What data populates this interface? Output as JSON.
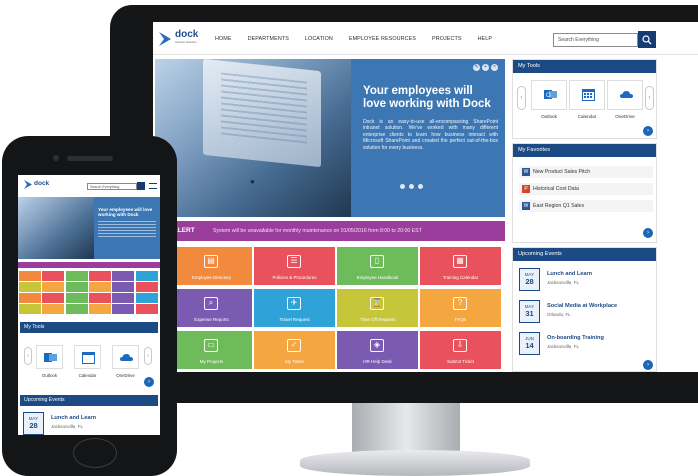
{
  "desktop": {
    "brand": {
      "name": "dock",
      "tagline": "Intranet Solution"
    },
    "nav": [
      "HOME",
      "DEPARTMENTS",
      "LOCATION",
      "EMPLOYEE RESOURCES",
      "PROJECTS",
      "HELP"
    ],
    "search": {
      "placeholder": "Search Everything"
    },
    "hero": {
      "title": "Your employees will love working with Dock",
      "body": "Dock is an easy-to-use all-encompassing SharePoint intranet solution. We've worked with many different enterprise clients to learn how business interact with Microsoft SharePoint and created the perfect out-of-the-box solution for every business.",
      "dots": 3
    },
    "alert": {
      "label": "ALERT",
      "text": "System will be unavailable for monthly maintenance on 01/05/2016 from 8:00 to 20:00 EST"
    },
    "tiles": [
      {
        "label": "Employee Directory",
        "color": "#f28a3e",
        "icon": "directory-icon"
      },
      {
        "label": "Policies & Procedures",
        "color": "#e9515c",
        "icon": "policies-icon"
      },
      {
        "label": "Employee Handbook",
        "color": "#6dbb5b",
        "icon": "handbook-icon"
      },
      {
        "label": "Training Calendar",
        "color": "#e9515c",
        "icon": "calendar-icon"
      },
      {
        "label": "Expense Reports",
        "color": "#7b5ab1",
        "icon": "expense-icon"
      },
      {
        "label": "Travel Request",
        "color": "#2fa3d8",
        "icon": "travel-icon"
      },
      {
        "label": "Time Off Request",
        "color": "#c7c63a",
        "icon": "hourglass-icon"
      },
      {
        "label": "FAQs",
        "color": "#f4a640",
        "icon": "faq-icon"
      },
      {
        "label": "My Projects",
        "color": "#6dbb5b",
        "icon": "projects-icon"
      },
      {
        "label": "My Tasks",
        "color": "#f4a640",
        "icon": "tasks-icon"
      },
      {
        "label": "HR Help Desk",
        "color": "#7b5ab1",
        "icon": "handshake-icon"
      },
      {
        "label": "Submit Ticket",
        "color": "#e9515c",
        "icon": "ticket-icon"
      }
    ],
    "my_tools": {
      "title": "My Tools",
      "items": [
        "Outlook",
        "Calendar",
        "OneDrive"
      ]
    },
    "my_favorites": {
      "title": "My Favorites",
      "items": [
        {
          "label": "New Product Sales Pitch",
          "icon": "word-icon",
          "color": "#2b5797"
        },
        {
          "label": "Historical Cost Data",
          "icon": "powerpoint-icon",
          "color": "#d24726"
        },
        {
          "label": "East Region Q1 Sales",
          "icon": "word-icon",
          "color": "#2b5797"
        }
      ]
    },
    "events": {
      "title": "Upcoming Events",
      "items": [
        {
          "month": "MAY",
          "day": "28",
          "title": "Lunch and Learn",
          "location": "Jacksonville, FL"
        },
        {
          "month": "MAY",
          "day": "31",
          "title": "Social Media at Workplace",
          "location": "Orlando, FL"
        },
        {
          "month": "JUN",
          "day": "14",
          "title": "On-boarding Training",
          "location": "Jacksonville, FL"
        }
      ]
    }
  },
  "mobile": {
    "brand": "dock",
    "search": {
      "placeholder": "Search Everything"
    },
    "hero_title": "Your employees will love working with Dock",
    "my_tools": {
      "title": "My Tools",
      "items": [
        "Outlook",
        "Calendar",
        "OneDrive"
      ]
    },
    "events": {
      "title": "Upcoming Events",
      "item": {
        "month": "MAY",
        "day": "28",
        "title": "Lunch and Learn",
        "location": "Jacksonville, FL"
      }
    }
  },
  "colors": {
    "primary": "#1c4a84",
    "hero": "#3d77b3",
    "alert": "#9b3d9c",
    "device": "#151617"
  }
}
